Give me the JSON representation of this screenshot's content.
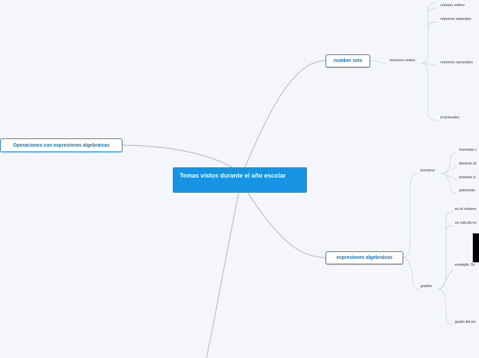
{
  "central": {
    "title": "Temas vistos durante el año escolar"
  },
  "topics": {
    "operaciones": "Operaciones con expresiones algebraicas",
    "number_sets": "number sets",
    "expresiones": "expresiones algebraicas"
  },
  "number_sets": {
    "numeros_reales": "números reales",
    "numero_entero": "número entero",
    "numeros_naturales": "números naturales",
    "numeros_racionales": "números  racionales",
    "irracionales": "irracionales"
  },
  "expresiones": {
    "terminos": "terminos",
    "monomio": "monomio (",
    "binomio": "binomio (d",
    "trinomio": "trinomio (t",
    "polinomio": "polinomio",
    "grados": "grados",
    "es_el_numero": "es el número",
    "se_calcula": "se calcula en",
    "example": "example:  5x",
    "grado_del_po": "grado del po"
  },
  "colors": {
    "background": "#f4f6fc",
    "central": "#1793e4",
    "topic_border": "#1a83d4",
    "topic_text": "#1674c4",
    "connector": "#b8bcc6",
    "sub_connector": "#cdd8e4"
  }
}
